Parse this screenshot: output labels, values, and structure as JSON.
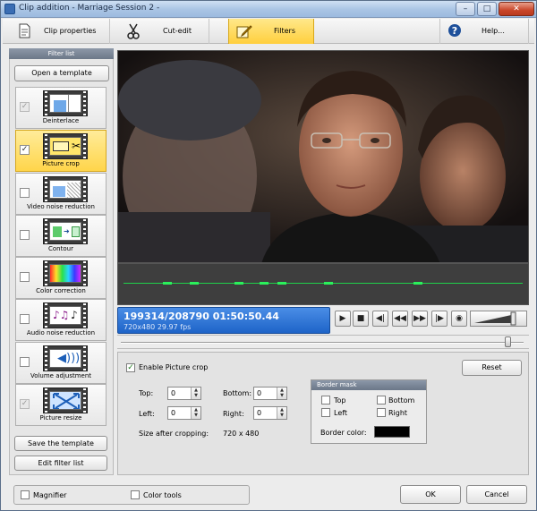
{
  "window": {
    "title": "Clip addition - Marriage Session 2 -",
    "min_symbol": "–",
    "max_symbol": "□",
    "close_symbol": "✕"
  },
  "tabs": [
    {
      "label": "Clip properties",
      "icon": "document-icon"
    },
    {
      "label": "Cut-edit",
      "icon": "scissors-icon"
    },
    {
      "label": "Filters",
      "icon": "pencil-icon",
      "active": true
    },
    {
      "label": "Help...",
      "icon": "help-icon"
    }
  ],
  "filter_panel": {
    "header": "Filter list",
    "open_template": "Open a template",
    "save_template": "Save the template",
    "edit_list": "Edit filter list",
    "filters": [
      {
        "name": "Deinterlace",
        "checked": true,
        "disabled": true,
        "icon": "deinterlace-icon"
      },
      {
        "name": "Picture crop",
        "checked": true,
        "selected": true,
        "icon": "picture-crop-icon"
      },
      {
        "name": "Video noise reduction",
        "checked": false,
        "icon": "video-noise-icon"
      },
      {
        "name": "Contour",
        "checked": false,
        "icon": "contour-icon"
      },
      {
        "name": "Color correction",
        "checked": false,
        "icon": "color-correction-icon"
      },
      {
        "name": "Audio noise reduction",
        "checked": false,
        "icon": "audio-noise-icon"
      },
      {
        "name": "Volume adjustment",
        "checked": false,
        "icon": "volume-icon"
      },
      {
        "name": "Picture resize",
        "checked": true,
        "disabled": true,
        "icon": "picture-resize-icon"
      }
    ]
  },
  "player": {
    "frame_time": "199314/208790  01:50:50.44",
    "format": "720x480 29.97  fps",
    "seek_position": 0.96,
    "volume_level": 0.88
  },
  "settings": {
    "enable_label": "Enable Picture crop",
    "enable_checked": true,
    "reset": "Reset",
    "top_label": "Top:",
    "top_value": "0",
    "left_label": "Left:",
    "left_value": "0",
    "bottom_label": "Bottom:",
    "bottom_value": "0",
    "right_label": "Right:",
    "right_value": "0",
    "size_label": "Size after cropping:",
    "size_value": "720 x 480",
    "border_mask": {
      "title": "Border mask",
      "top": "Top",
      "bottom": "Bottom",
      "left": "Left",
      "right": "Right",
      "color_label": "Border color:",
      "color": "#000000"
    }
  },
  "footer": {
    "magnifier": "Magnifier",
    "color_tools": "Color tools",
    "ok": "OK",
    "cancel": "Cancel"
  },
  "colors": {
    "active_tab": "#ffd54a",
    "time_panel": "#1e64c8",
    "waveform": "#1fd24a"
  }
}
